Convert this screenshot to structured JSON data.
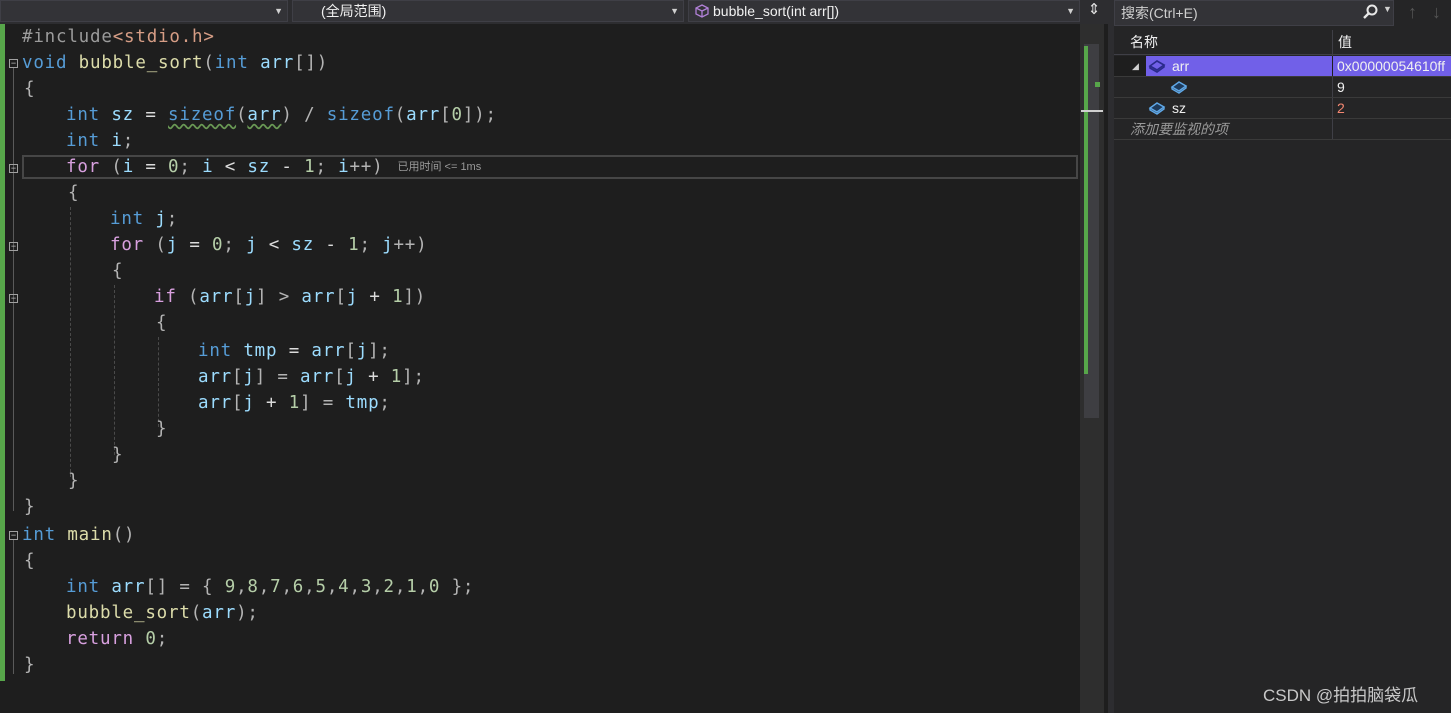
{
  "navbar": {
    "project_combo": "",
    "scope_combo": "(全局范围)",
    "function_combo": "bubble_sort(int arr[])",
    "split_label": "⇕"
  },
  "editor": {
    "perf_tip": "已用时间 <= 1ms",
    "lines": {
      "l1a": "#include",
      "l1b": "<stdio.h>",
      "l2a": "void",
      "l2b": " bubble_sort",
      "l2c": "(",
      "l2d": "int",
      "l2e": " arr",
      "l2f": "[])",
      "l3": "{",
      "l4a": "int",
      "l4b": " sz",
      "l4c": " = ",
      "l4d": "sizeof",
      "l4e": "(",
      "l4f": "arr",
      "l4g": ") / ",
      "l4h": "sizeof",
      "l4i": "(",
      "l4j": "arr",
      "l4k": "[",
      "l4l": "0",
      "l4m": "]);",
      "l5a": "int",
      "l5b": " i",
      "l5c": ";",
      "l6a": "for",
      "l6b": " (",
      "l6c": "i",
      "l6d": " = ",
      "l6e": "0",
      "l6f": "; ",
      "l6g": "i",
      "l6h": " < ",
      "l6i": "sz",
      "l6j": " - ",
      "l6k": "1",
      "l6l": "; ",
      "l6m": "i",
      "l6n": "++)",
      "l7": "{",
      "l8a": "int",
      "l8b": " j",
      "l8c": ";",
      "l9a": "for",
      "l9b": " (",
      "l9c": "j",
      "l9d": " = ",
      "l9e": "0",
      "l9f": "; ",
      "l9g": "j",
      "l9h": " < ",
      "l9i": "sz",
      "l9j": " - ",
      "l9k": "1",
      "l9l": "; ",
      "l9m": "j",
      "l9n": "++)",
      "l10": "{",
      "l11a": "if",
      "l11b": " (",
      "l11c": "arr",
      "l11d": "[",
      "l11e": "j",
      "l11f": "] > ",
      "l11g": "arr",
      "l11h": "[",
      "l11i": "j",
      "l11j": " + ",
      "l11k": "1",
      "l11l": "])",
      "l12": "{",
      "l13a": "int",
      "l13b": " tmp",
      "l13c": " = ",
      "l13d": "arr",
      "l13e": "[",
      "l13f": "j",
      "l13g": "];",
      "l14a": "arr",
      "l14b": "[",
      "l14c": "j",
      "l14d": "] = ",
      "l14e": "arr",
      "l14f": "[",
      "l14g": "j",
      "l14h": " + ",
      "l14i": "1",
      "l14j": "];",
      "l15a": "arr",
      "l15b": "[",
      "l15c": "j",
      "l15d": " + ",
      "l15e": "1",
      "l15f": "] = ",
      "l15g": "tmp",
      "l15h": ";",
      "l16": "}",
      "l17": "}",
      "l18": "}",
      "l19": "}",
      "l20a": "int",
      "l20b": " main",
      "l20c": "()",
      "l21": "{",
      "l22a": "int",
      "l22b": " arr",
      "l22c": "[] = { ",
      "l22d": "9",
      "l22e": ",",
      "l22f": "8",
      "l22g": ",",
      "l22h": "7",
      "l22i": ",",
      "l22j": "6",
      "l22k": ",",
      "l22l": "5",
      "l22m": ",",
      "l22n": "4",
      "l22o": ",",
      "l22p": "3",
      "l22q": ",",
      "l22r": "2",
      "l22s": ",",
      "l22t": "1",
      "l22u": ",",
      "l22v": "0",
      "l22w": " };",
      "l23a": "bubble_sort",
      "l23b": "(",
      "l23c": "arr",
      "l23d": ");",
      "l24a": "return",
      "l24b": " ",
      "l24c": "0",
      "l24d": ";",
      "l25": "}"
    }
  },
  "watch": {
    "search_placeholder": "搜索(Ctrl+E)",
    "col_name": "名称",
    "col_value": "值",
    "rows": [
      {
        "name": "arr",
        "value": "0x00000054610ff"
      },
      {
        "name": "",
        "value": "9"
      },
      {
        "name": "sz",
        "value": "2"
      }
    ],
    "add_item": "添加要监视的项"
  },
  "watermark": "CSDN @拍拍脑袋瓜",
  "colors": {
    "keyword": "#569cd6",
    "variable": "#9cdcfe",
    "function": "#dcdcaa",
    "number": "#b5cea8",
    "selection": "#7160e8",
    "changed_value": "#f48771",
    "change_bar": "#57a64a"
  }
}
